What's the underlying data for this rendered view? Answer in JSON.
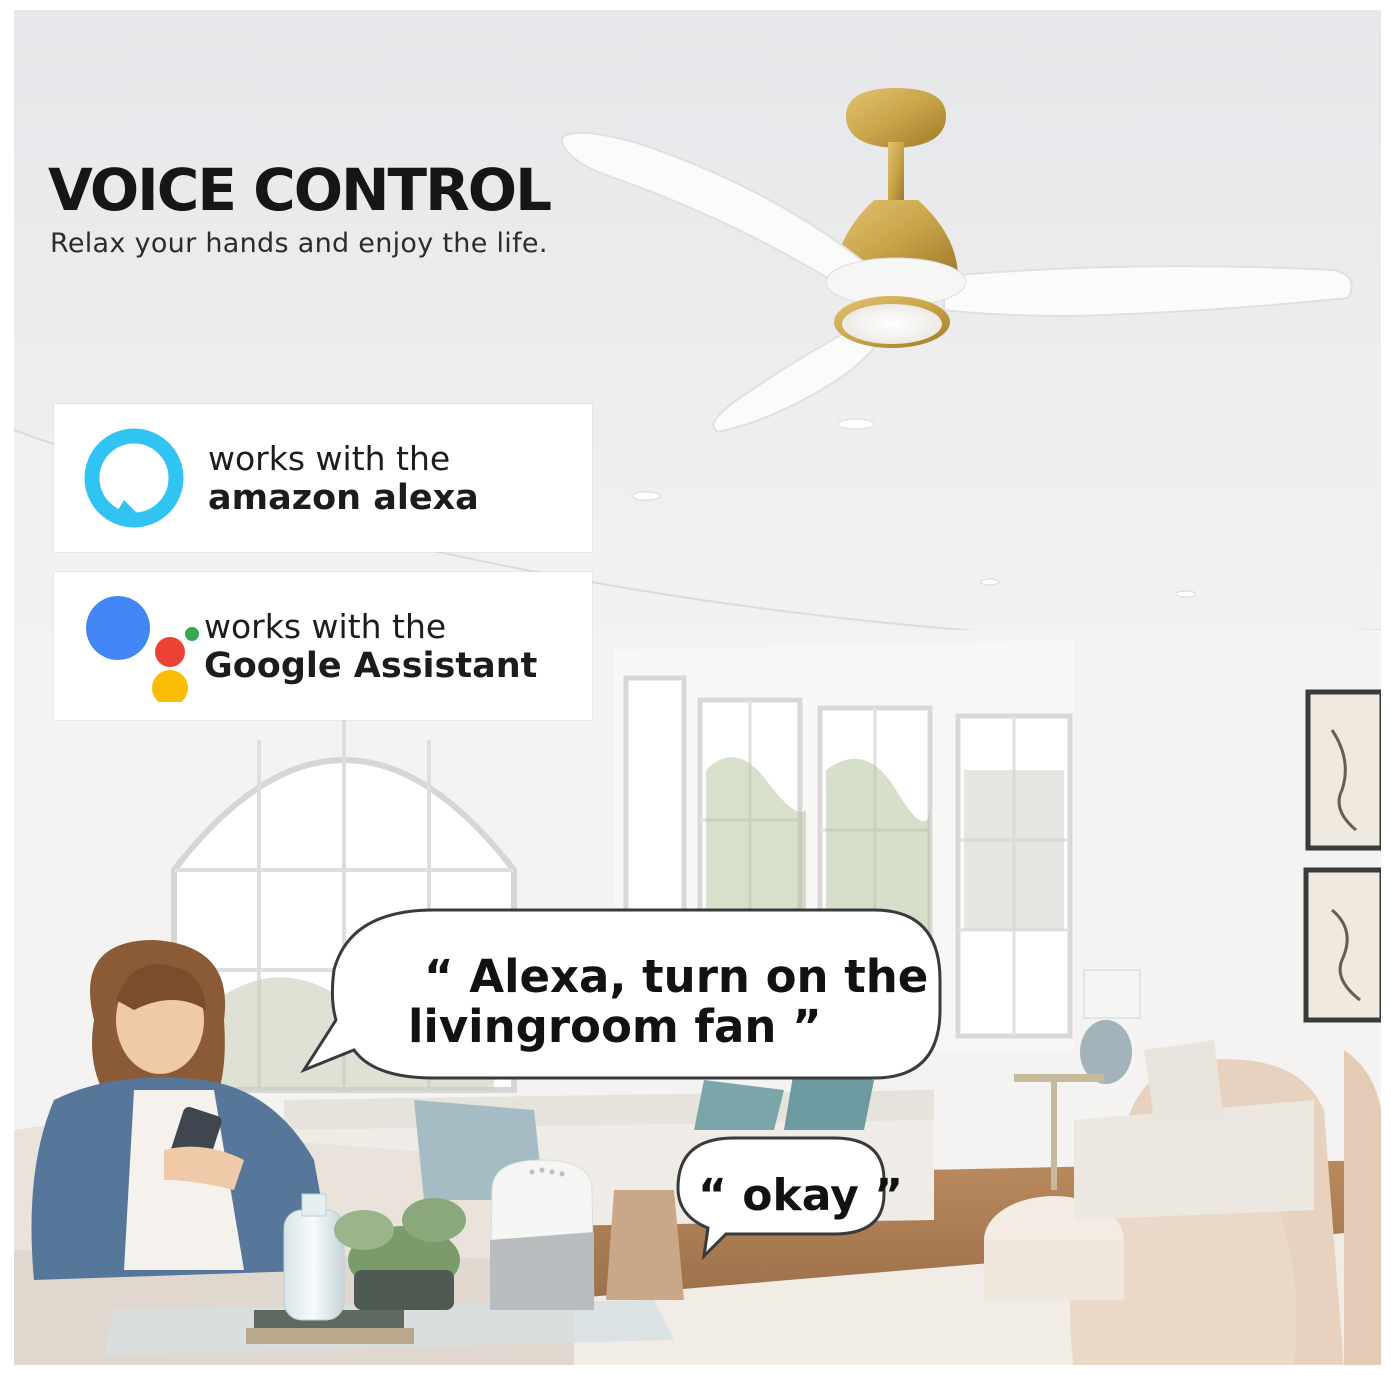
{
  "headline": {
    "title": "VOICE CONTROL",
    "subtitle": "Relax your hands and enjoy the life."
  },
  "badges": {
    "alexa": {
      "line1": "works with the",
      "line2": "amazon alexa",
      "icon": "alexa-ring-icon",
      "color": "#31c4f3"
    },
    "google": {
      "line1": "works with the",
      "line2": "Google Assistant",
      "icon": "google-assistant-dots-icon",
      "colors": [
        "#4285f4",
        "#ea4335",
        "#fbbc05",
        "#34a853"
      ]
    }
  },
  "speech": {
    "command_line1": "“ Alexa, turn on the",
    "command_line2": "livingroom fan ”",
    "reply": "“ okay ”"
  },
  "colors": {
    "fan_gold": "#c9a448",
    "fan_blade": "#fbfbfb",
    "text_dark": "#161616"
  }
}
